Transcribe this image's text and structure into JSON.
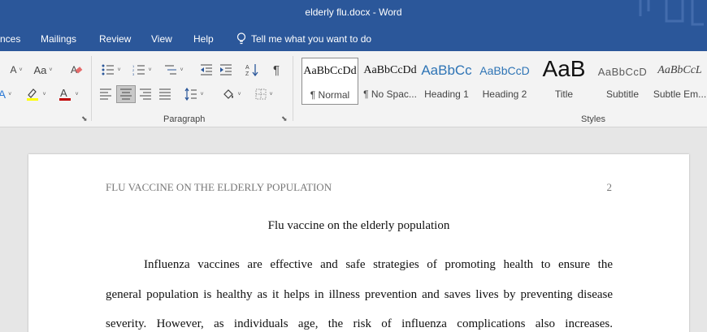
{
  "window": {
    "title": "elderly flu.docx  -  Word"
  },
  "menu": {
    "tabs": [
      "nces",
      "Mailings",
      "Review",
      "View",
      "Help"
    ],
    "tell_me": "Tell me what you want to do"
  },
  "ribbon": {
    "font_partial": {
      "grow_label": "A",
      "case_label": "Aa",
      "color_label": "A",
      "color_accent": "#c00000",
      "highlight_color": "#ffff00"
    },
    "paragraph": {
      "label": "Paragraph",
      "pilcrow": "¶"
    },
    "styles": {
      "label": "Styles",
      "items": [
        {
          "preview": "AaBbCcDd",
          "label": "¶ Normal"
        },
        {
          "preview": "AaBbCcDd",
          "label": "¶ No Spac..."
        },
        {
          "preview": "AaBbCc",
          "label": "Heading 1"
        },
        {
          "preview": "AaBbCcD",
          "label": "Heading 2"
        },
        {
          "preview": "AaB",
          "label": "Title"
        },
        {
          "preview": "AaBbCcD",
          "label": "Subtitle"
        },
        {
          "preview": "AaBbCcL",
          "label": "Subtle Em..."
        }
      ],
      "selected_index": 0
    }
  },
  "document": {
    "running_head": "FLU VACCINE ON THE ELDERLY POPULATION",
    "page_number": "2",
    "title": "Flu vaccine on the elderly population",
    "lines": [
      "Influenza vaccines are effective and safe strategies of promoting health to ensure the",
      "general population is healthy as it helps in illness prevention and saves lives by preventing disease",
      "severity. However, as individuals age, the risk of influenza complications also increases."
    ]
  },
  "colors": {
    "brand": "#2b579a",
    "ribbon": "#f3f3f3",
    "canvas": "#e6e6e6"
  }
}
